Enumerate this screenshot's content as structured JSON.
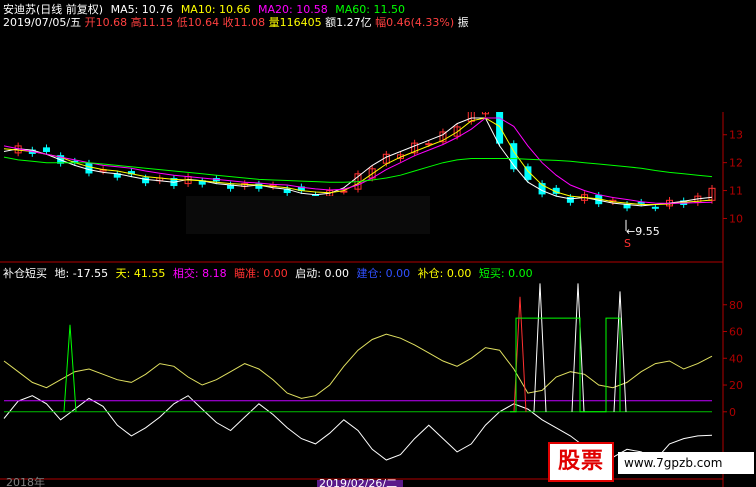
{
  "header": {
    "stock_name": "安迪苏(日线 前复权)",
    "ma5": "MA5: 10.76",
    "ma10": "MA10: 10.66",
    "ma20": "MA20: 10.58",
    "ma60": "MA60: 11.50",
    "date": "2019/07/05/五",
    "open": "开10.68",
    "high": "高11.15",
    "low": "低10.64",
    "close": "收11.08",
    "volume": "量116405",
    "amount": "额1.27亿",
    "change": "幅0.46(4.33%)",
    "amplitude": "振"
  },
  "indicator_header": {
    "name": "补仓短买",
    "di": "地: -17.55",
    "tian": "天: 41.55",
    "xiangjiao": "相交: 8.18",
    "diuzhun": "瞄准: 0.00",
    "qidong": "启动: 0.00",
    "jiancang": "建仓: 0.00",
    "bucang": "补仓: 0.00",
    "duanmai": "短买: 0.00"
  },
  "annotations": {
    "low_marker": "←9.55",
    "s_marker": "S"
  },
  "x_axis": {
    "left_partial": "2018年",
    "date_label": "2019/02/26/二"
  },
  "watermark": {
    "logo": "股票",
    "site": "www.7gpzb.com"
  },
  "colors": {
    "up": "#ff3030",
    "down": "#00ffff",
    "ma5": "#ffffff",
    "ma10": "#ffff00",
    "ma20": "#ff00ff",
    "ma60": "#00ff00",
    "axis": "#b00000"
  },
  "chart_data": [
    {
      "type": "candlestick",
      "title": "安迪苏(日线 前复权)",
      "y_ticks": [
        10,
        11,
        12,
        13
      ],
      "ylim": [
        9.3,
        13.6
      ],
      "last": {
        "open": 10.68,
        "high": 11.15,
        "low": 10.64,
        "close": 11.08
      },
      "period_low": 9.55,
      "series": [
        {
          "name": "MA5",
          "last": 10.76,
          "values": [
            12.4,
            12.5,
            12.45,
            12.3,
            12.1,
            11.9,
            11.75,
            11.65,
            11.6,
            11.5,
            11.4,
            11.35,
            11.3,
            11.4,
            11.35,
            11.25,
            11.2,
            11.15,
            11.2,
            11.1,
            11.05,
            10.9,
            10.85,
            10.9,
            11.1,
            11.5,
            11.9,
            12.2,
            12.4,
            12.6,
            12.8,
            13.0,
            13.4,
            13.8,
            14.0,
            12.6,
            11.9,
            11.3,
            11.0,
            10.8,
            10.7,
            10.75,
            10.65,
            10.55,
            10.5,
            10.45,
            10.5,
            10.55,
            10.62,
            10.7,
            10.76
          ]
        },
        {
          "name": "MA10",
          "last": 10.66,
          "values": [
            12.5,
            12.45,
            12.4,
            12.3,
            12.2,
            12.0,
            11.85,
            11.75,
            11.7,
            11.6,
            11.5,
            11.45,
            11.4,
            11.38,
            11.35,
            11.3,
            11.25,
            11.22,
            11.2,
            11.15,
            11.1,
            11.0,
            10.95,
            10.92,
            11.0,
            11.25,
            11.6,
            11.95,
            12.2,
            12.4,
            12.6,
            12.8,
            13.1,
            13.5,
            13.9,
            13.3,
            12.4,
            11.7,
            11.2,
            10.95,
            10.8,
            10.75,
            10.7,
            10.6,
            10.55,
            10.5,
            10.5,
            10.52,
            10.58,
            10.62,
            10.66
          ]
        },
        {
          "name": "MA20",
          "last": 10.58,
          "values": [
            12.6,
            12.5,
            12.4,
            12.3,
            12.2,
            12.1,
            12.0,
            11.9,
            11.85,
            11.8,
            11.7,
            11.62,
            11.55,
            11.5,
            11.45,
            11.4,
            11.35,
            11.3,
            11.27,
            11.22,
            11.2,
            11.12,
            11.06,
            11.02,
            11.05,
            11.2,
            11.45,
            11.75,
            12.0,
            12.25,
            12.45,
            12.65,
            12.9,
            13.2,
            13.6,
            13.8,
            13.3,
            12.6,
            12.0,
            11.55,
            11.2,
            11.0,
            10.85,
            10.75,
            10.68,
            10.6,
            10.55,
            10.54,
            10.55,
            10.57,
            10.58
          ]
        },
        {
          "name": "MA60",
          "last": 11.5,
          "values": [
            12.2,
            12.1,
            12.05,
            12.0,
            12.0,
            12.0,
            12.0,
            11.95,
            11.9,
            11.85,
            11.8,
            11.75,
            11.7,
            11.65,
            11.6,
            11.55,
            11.5,
            11.45,
            11.4,
            11.38,
            11.36,
            11.34,
            11.32,
            11.3,
            11.3,
            11.32,
            11.38,
            11.45,
            11.55,
            11.7,
            11.85,
            12.0,
            12.1,
            12.15,
            12.15,
            12.15,
            12.15,
            12.12,
            12.1,
            12.08,
            12.05,
            12.0,
            11.95,
            11.9,
            11.85,
            11.8,
            11.72,
            11.65,
            11.6,
            11.55,
            11.5
          ]
        }
      ]
    },
    {
      "type": "line",
      "title": "补仓短买",
      "y_ticks": [
        0,
        20,
        40,
        60,
        80
      ],
      "ylim": [
        -45,
        100
      ],
      "series": [
        {
          "name": "天",
          "last": 41.55,
          "values": [
            38,
            30,
            22,
            18,
            24,
            30,
            32,
            28,
            24,
            22,
            28,
            36,
            34,
            26,
            20,
            24,
            30,
            36,
            32,
            24,
            14,
            10,
            12,
            20,
            34,
            46,
            54,
            58,
            55,
            50,
            44,
            38,
            34,
            40,
            48,
            46,
            32,
            14,
            16,
            26,
            30,
            28,
            20,
            18,
            22,
            30,
            36,
            38,
            32,
            36,
            41.55
          ]
        },
        {
          "name": "地",
          "last": -17.55,
          "values": [
            -5,
            8,
            12,
            6,
            -6,
            2,
            10,
            4,
            -10,
            -18,
            -12,
            -4,
            6,
            12,
            2,
            -8,
            -14,
            -4,
            6,
            -2,
            -12,
            -20,
            -24,
            -16,
            -6,
            -14,
            -28,
            -36,
            -32,
            -20,
            -10,
            -20,
            -30,
            -24,
            -10,
            0,
            6,
            2,
            -6,
            -12,
            -18,
            -26,
            -32,
            -34,
            -28,
            -30,
            -36,
            -24,
            -20,
            -18,
            -17.55
          ]
        },
        {
          "name": "相交",
          "last": 8.18,
          "values": [
            8.18,
            8.18,
            8.18,
            8.18,
            8.18,
            8.18,
            8.18,
            8.18,
            8.18,
            8.18,
            8.18,
            8.18,
            8.18,
            8.18,
            8.18,
            8.18,
            8.18,
            8.18,
            8.18,
            8.18,
            8.18,
            8.18,
            8.18,
            8.18,
            8.18,
            8.18,
            8.18,
            8.18,
            8.18,
            8.18,
            8.18,
            8.18,
            8.18,
            8.18,
            8.18,
            8.18,
            8.18,
            8.18,
            8.18,
            8.18,
            8.18,
            8.18,
            8.18,
            8.18,
            8.18,
            8.18,
            8.18,
            8.18,
            8.18,
            8.18,
            8.18
          ]
        }
      ]
    }
  ]
}
